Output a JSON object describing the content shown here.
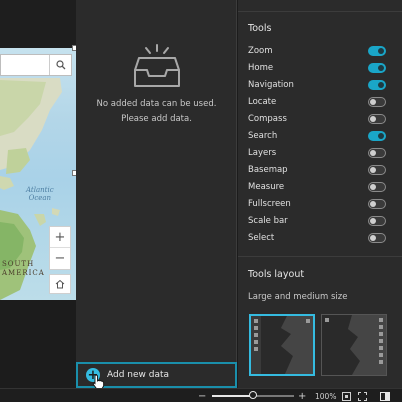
{
  "map": {
    "ocean_label": "Atlantic\nOcean",
    "continent_label": "SOUTH\nAMERICA"
  },
  "data_panel": {
    "empty_message": "No added data can be used.\nPlease add data.",
    "add_button_label": "Add new data"
  },
  "settings": {
    "tools_title": "Tools",
    "tools": [
      {
        "label": "Zoom",
        "on": true
      },
      {
        "label": "Home",
        "on": true
      },
      {
        "label": "Navigation",
        "on": true
      },
      {
        "label": "Locate",
        "on": false
      },
      {
        "label": "Compass",
        "on": false
      },
      {
        "label": "Search",
        "on": true
      },
      {
        "label": "Layers",
        "on": false
      },
      {
        "label": "Basemap",
        "on": false
      },
      {
        "label": "Measure",
        "on": false
      },
      {
        "label": "Fullscreen",
        "on": false
      },
      {
        "label": "Scale bar",
        "on": false
      },
      {
        "label": "Select",
        "on": false
      }
    ],
    "layout_title": "Tools layout",
    "layout_subtitle": "Large and medium size",
    "layout_options": [
      {
        "id": "layout-1",
        "selected": true
      },
      {
        "id": "layout-2",
        "selected": false
      }
    ]
  },
  "statusbar": {
    "zoom_percent": "100%",
    "zoom_level": 0.5
  },
  "colors": {
    "accent": "#1aa6c8",
    "panel": "#2b2b2b",
    "text": "#e0e0e0"
  }
}
